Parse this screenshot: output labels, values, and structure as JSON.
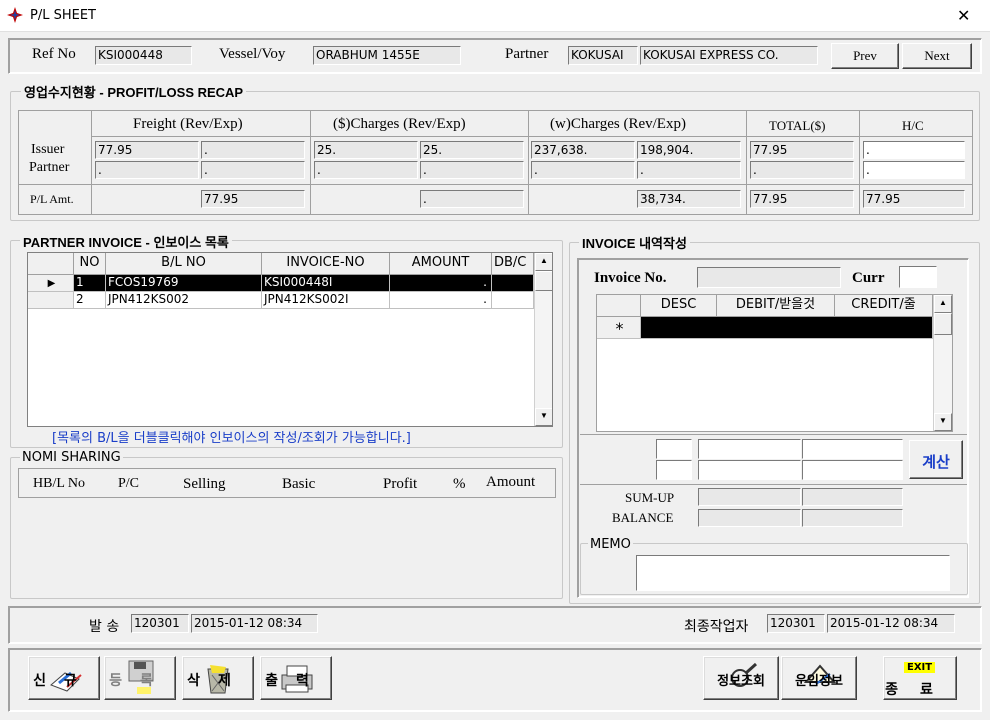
{
  "window": {
    "title": "P/L SHEET",
    "close_glyph": "✕"
  },
  "header": {
    "ref_label": "Ref No",
    "ref_value": "KSI000448",
    "vessel_label": "Vessel/Voy",
    "vessel_value": "ORABHUM 1455E",
    "partner_label": "Partner",
    "partner_code": "KOKUSAI",
    "partner_name": "KOKUSAI EXPRESS CO.",
    "prev_label": "Prev",
    "next_label": "Next"
  },
  "recap": {
    "title": "영업수지현황 - PROFIT/LOSS RECAP",
    "col_freight": "Freight (Rev/Exp)",
    "col_dollar": "($)Charges (Rev/Exp)",
    "col_won": "(w)Charges (Rev/Exp)",
    "col_total": "TOTAL($)",
    "col_hc": "H/C",
    "row_issuer": "Issuer",
    "row_partner": "Partner",
    "row_pl": "P/L Amt.",
    "issuer": [
      "77.95",
      ".",
      "25.",
      "25.",
      "237,638.",
      "198,904.",
      "77.95",
      "."
    ],
    "partner": [
      ".",
      ".",
      ".",
      ".",
      ".",
      ".",
      ".",
      "."
    ],
    "pl": [
      "77.95",
      ".",
      "38,734.",
      "77.95",
      "77.95"
    ]
  },
  "partner_invoice": {
    "title": "PARTNER INVOICE - 인보이스 목록",
    "headers": [
      "NO",
      "B/L NO",
      "INVOICE-NO",
      "AMOUNT",
      "DB/C"
    ],
    "rows": [
      {
        "no": "1",
        "bl": "FCOS19769",
        "inv": "KSI000448I",
        "amount": "."
      },
      {
        "no": "2",
        "bl": "JPN412KS002",
        "inv": "JPN412KS002I",
        "amount": "."
      }
    ],
    "row_pointer": "▶",
    "hint": "[목록의 B/L을 더블클릭해야 인보이스의 작성/조회가 가능합니다.]"
  },
  "nomi": {
    "title": "NOMI SHARING",
    "headers": [
      "HB/L No",
      "P/C",
      "Selling",
      "Basic",
      "Profit",
      "%",
      "Amount"
    ]
  },
  "invoice_detail": {
    "title": "INVOICE 내역작성",
    "invoice_no_label": "Invoice No.",
    "curr_label": "Curr",
    "headers": [
      "DESC",
      "DEBIT/받을것",
      "CREDIT/줄"
    ],
    "new_row_marker": "*",
    "calc_label": "계산",
    "sumup_label": "SUM-UP",
    "balance_label": "BALANCE",
    "memo_label": "MEMO"
  },
  "status": {
    "send_label": "발 송",
    "send_user": "120301",
    "send_time": "2015-01-12 08:34",
    "last_label": "최종작업자",
    "last_user": "120301",
    "last_time": "2015-01-12 08:34"
  },
  "toolbar": {
    "new": "신규",
    "register": "등록",
    "delete": "삭제",
    "print": "출력",
    "info_query": "정보조회",
    "freight_info": "운임정보",
    "exit_badge": "EXIT",
    "exit": "종료"
  }
}
